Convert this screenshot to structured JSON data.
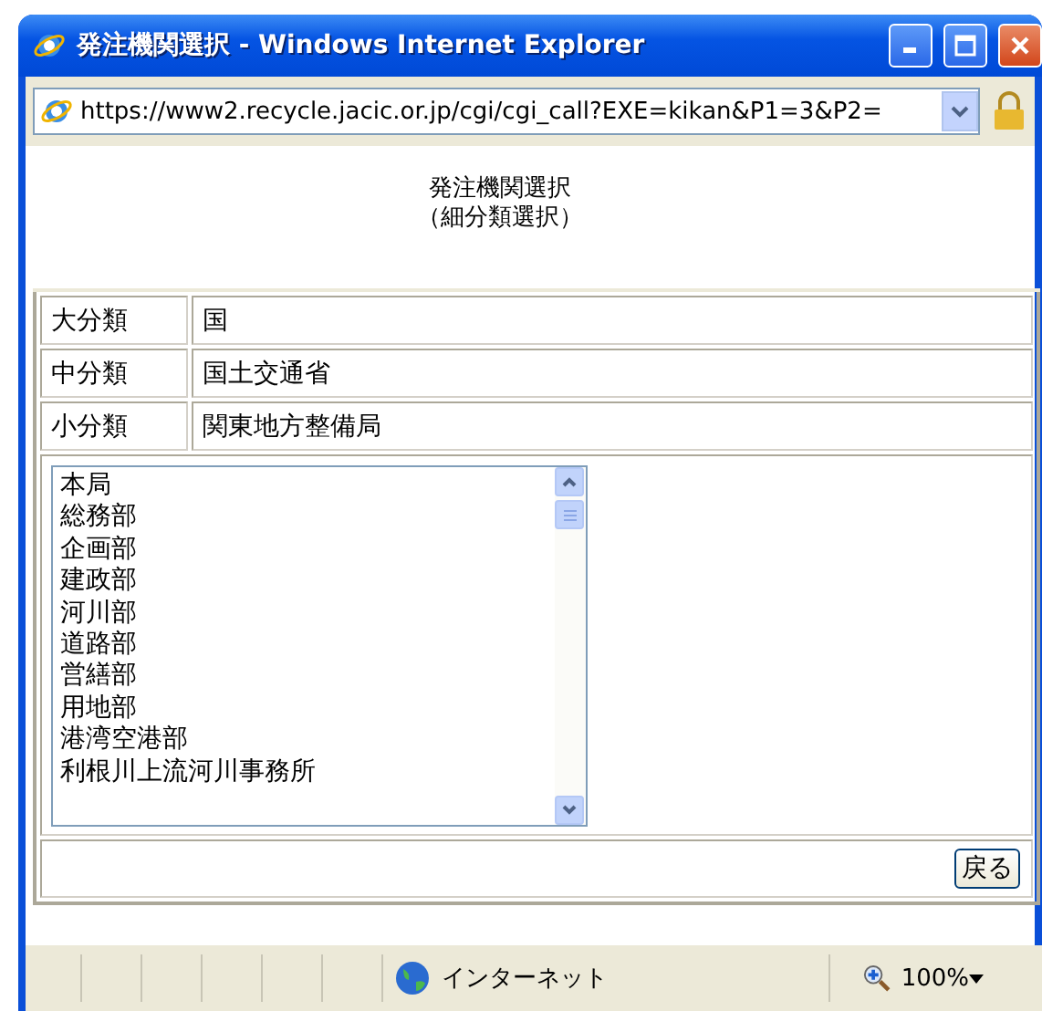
{
  "window": {
    "title": "発注機関選択 - Windows Internet Explorer"
  },
  "address_bar": {
    "url": "https://www2.recycle.jacic.or.jp/cgi/cgi_call?EXE=kikan&P1=3&P2="
  },
  "heading": [
    "発注機関選択",
    "（細分類選択）"
  ],
  "fields": [
    {
      "label": "大分類",
      "value": "国"
    },
    {
      "label": "中分類",
      "value": "国土交通省"
    },
    {
      "label": "小分類",
      "value": "関東地方整備局"
    }
  ],
  "listbox": {
    "items": [
      {
        "label": "本局",
        "selected": false
      },
      {
        "label": "総務部",
        "selected": false
      },
      {
        "label": "企画部",
        "selected": false
      },
      {
        "label": "建政部",
        "selected": false
      },
      {
        "label": "河川部",
        "selected": false
      },
      {
        "label": "道路部",
        "selected": false
      },
      {
        "label": "営繕部",
        "selected": false
      },
      {
        "label": "用地部",
        "selected": false
      },
      {
        "label": "港湾空港部",
        "selected": false
      },
      {
        "label": "利根川上流河川事務所",
        "selected": false
      }
    ]
  },
  "back_button": "戻る",
  "status_bar": {
    "zone": "インターネット",
    "zoom": "100%"
  }
}
